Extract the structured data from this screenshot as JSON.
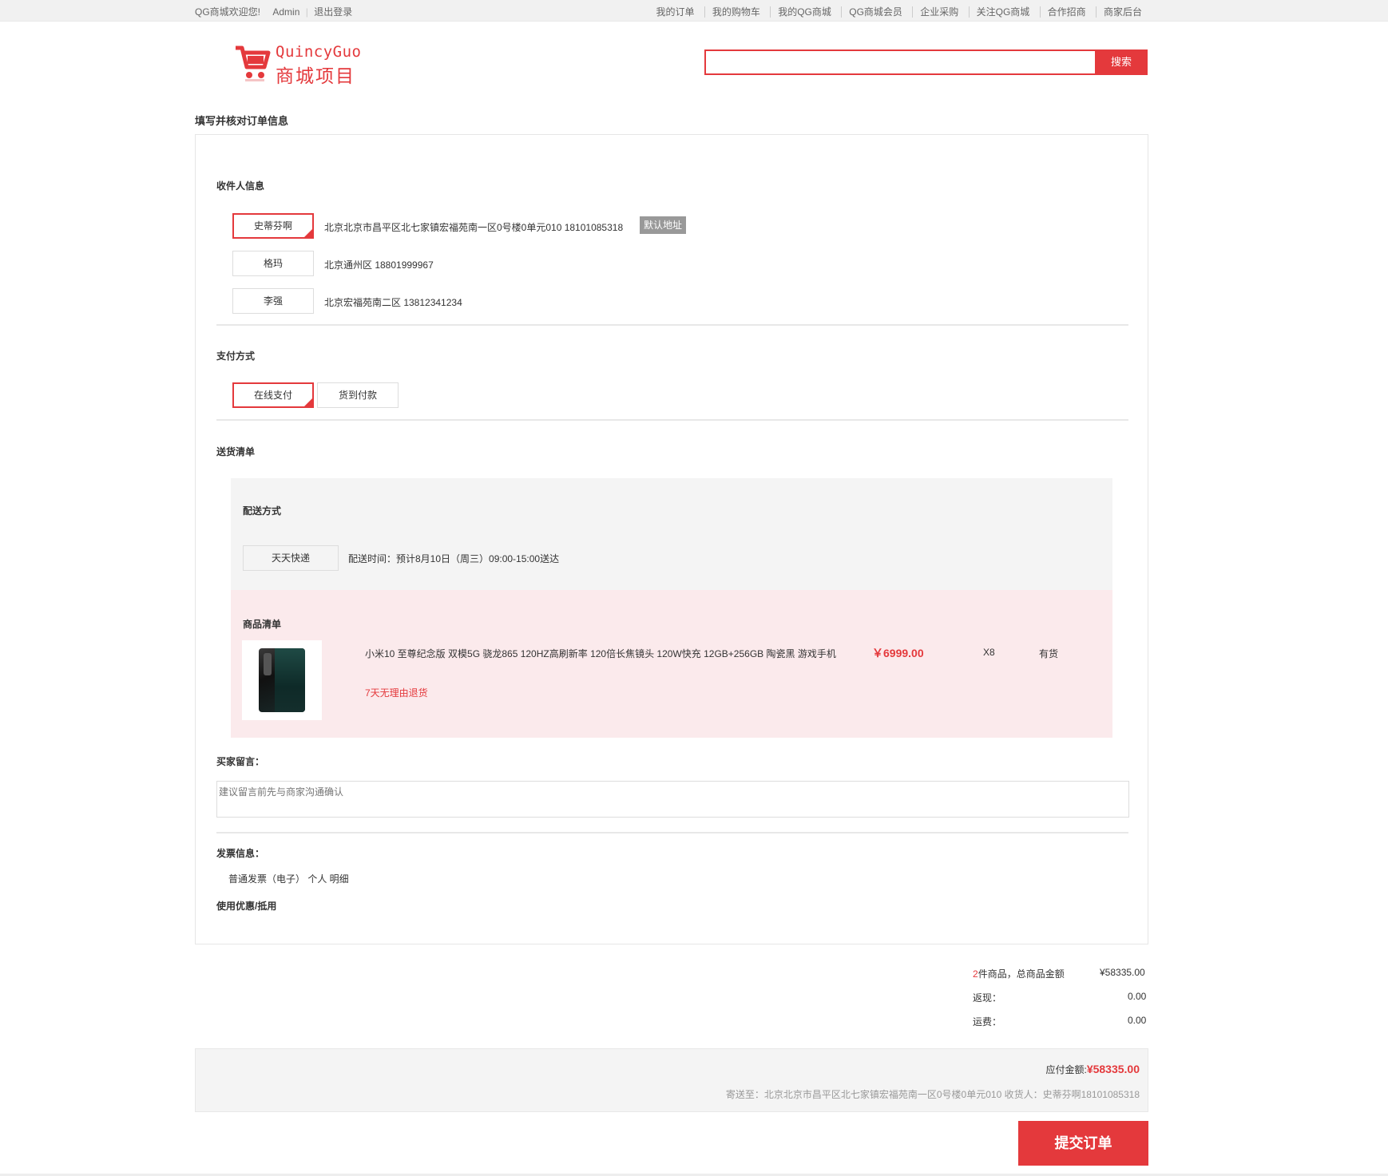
{
  "topbar": {
    "welcome": "QG商城欢迎您!",
    "user": "Admin",
    "logout": "退出登录",
    "links": [
      "我的订单",
      "我的购物车",
      "我的QG商城",
      "QG商城会员",
      "企业采购",
      "关注QG商城",
      "合作招商",
      "商家后台"
    ]
  },
  "logo": {
    "line1": "QuincyGuo",
    "line2": "商城项目",
    "icon": "shopping-cart-icon"
  },
  "search": {
    "value": "",
    "placeholder": "",
    "button": "搜索"
  },
  "page_title": "填写并核对订单信息",
  "receiver": {
    "title": "收件人信息",
    "addresses": [
      {
        "name": "史蒂芬啊",
        "address": "北京北京市昌平区北七家镇宏福苑南一区0号楼0单元010  18101085318",
        "selected": true,
        "default_label": "默认地址"
      },
      {
        "name": "格玛",
        "address": "北京通州区  18801999967",
        "selected": false
      },
      {
        "name": "李强",
        "address": "北京宏福苑南二区  13812341234",
        "selected": false
      }
    ]
  },
  "payment": {
    "title": "支付方式",
    "options": [
      {
        "label": "在线支付",
        "selected": true
      },
      {
        "label": "货到付款",
        "selected": false
      }
    ]
  },
  "delivery": {
    "title": "送货清单",
    "method_title": "配送方式",
    "method": "天天快递",
    "time": "配送时间：预计8月10日（周三）09:00-15:00送达"
  },
  "goods": {
    "title": "商品清单",
    "items": [
      {
        "name": "小米10 至尊纪念版 双模5G 骁龙865 120HZ高刷新率 120倍长焦镜头 120W快充 12GB+256GB 陶瓷黑 游戏手机",
        "price": "￥6999.00",
        "qty": "X8",
        "stock": "有货",
        "return_policy": "7天无理由退货"
      }
    ]
  },
  "message": {
    "title": "买家留言：",
    "placeholder": "建议留言前先与商家沟通确认"
  },
  "invoice": {
    "title": "发票信息：",
    "content": "普通发票（电子） 个人 明细"
  },
  "coupon": {
    "title": "使用优惠/抵用"
  },
  "summary": {
    "count": "2",
    "count_suffix": "件商品，总商品金额",
    "total": "¥58335.00",
    "cashback_label": "返现：",
    "cashback": "0.00",
    "freight_label": "运费：",
    "freight": "0.00"
  },
  "pay": {
    "label": "应付金额:",
    "amount": "¥58335.00",
    "ship_to": "寄送至：北京北京市昌平区北七家镇宏福苑南一区0号楼0单元010 收货人：史蒂芬啊18101085318"
  },
  "submit": "提交订单",
  "colors": {
    "accent": "#e4393c",
    "goods_bg": "#fbeaec",
    "panel_bg": "#f4f4f4"
  }
}
